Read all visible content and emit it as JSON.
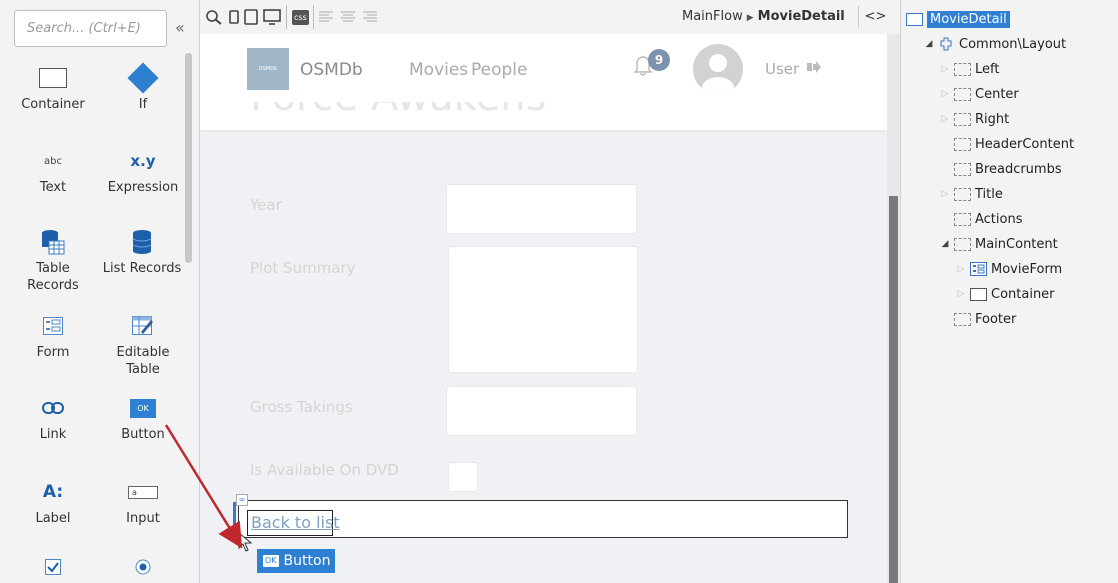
{
  "toolbox": {
    "search_placeholder": "Search... (Ctrl+E)",
    "collapse_glyph": "«",
    "tools": [
      {
        "name": "container",
        "label": "Container"
      },
      {
        "name": "if",
        "label": "If"
      },
      {
        "name": "text",
        "label": "Text",
        "icon_text": "abc"
      },
      {
        "name": "expression",
        "label": "Expression",
        "icon_text": "x.y"
      },
      {
        "name": "table-records",
        "label": "Table Records"
      },
      {
        "name": "list-records",
        "label": "List Records"
      },
      {
        "name": "form",
        "label": "Form"
      },
      {
        "name": "editable-table",
        "label": "Editable Table"
      },
      {
        "name": "link",
        "label": "Link"
      },
      {
        "name": "button",
        "label": "Button",
        "icon_text": "OK"
      },
      {
        "name": "label",
        "label": "Label",
        "icon_text": "A:"
      },
      {
        "name": "input",
        "label": "Input",
        "icon_text": "a"
      },
      {
        "name": "checkbox",
        "label": ""
      },
      {
        "name": "radio",
        "label": ""
      }
    ]
  },
  "toolbar": {
    "css_label": "css",
    "breadcrumb": {
      "flow": "MainFlow",
      "separator": "▶",
      "screen": "MovieDetail"
    },
    "code_toggle": "<>"
  },
  "app": {
    "logo_text": "OSMDb",
    "brand": "OSMDb",
    "nav": [
      "Movies",
      "People"
    ],
    "notification_count": "9",
    "user_label": "User",
    "page_title": "Force Awakens",
    "fields": [
      {
        "label": "Year"
      },
      {
        "label": "Plot Summary"
      },
      {
        "label": "Gross Takings"
      },
      {
        "label": "Is Available On DVD"
      }
    ],
    "back_link": "Back to list",
    "drag_ghost": {
      "icon_text": "OK",
      "label": "Button"
    }
  },
  "tree": [
    {
      "label": "MovieDetail",
      "depth": 0,
      "expander": "",
      "icon": "screen",
      "selected": true
    },
    {
      "label": "Common\\Layout",
      "depth": 1,
      "expander": "◢",
      "icon": "block"
    },
    {
      "label": "Left",
      "depth": 2,
      "expander": "▷",
      "icon": "placeholder"
    },
    {
      "label": "Center",
      "depth": 2,
      "expander": "▷",
      "icon": "placeholder"
    },
    {
      "label": "Right",
      "depth": 2,
      "expander": "▷",
      "icon": "placeholder"
    },
    {
      "label": "HeaderContent",
      "depth": 2,
      "expander": "",
      "icon": "placeholder"
    },
    {
      "label": "Breadcrumbs",
      "depth": 2,
      "expander": "",
      "icon": "placeholder"
    },
    {
      "label": "Title",
      "depth": 2,
      "expander": "▷",
      "icon": "placeholder"
    },
    {
      "label": "Actions",
      "depth": 2,
      "expander": "",
      "icon": "placeholder"
    },
    {
      "label": "MainContent",
      "depth": 2,
      "expander": "◢",
      "icon": "placeholder"
    },
    {
      "label": "MovieForm",
      "depth": 3,
      "expander": "▷",
      "icon": "form"
    },
    {
      "label": "Container",
      "depth": 3,
      "expander": "▷",
      "icon": "container"
    },
    {
      "label": "Footer",
      "depth": 2,
      "expander": "",
      "icon": "placeholder"
    }
  ],
  "colors": {
    "accent": "#2f80d3",
    "selection": "#2f80d3",
    "drag_arrow": "#c0282d"
  }
}
